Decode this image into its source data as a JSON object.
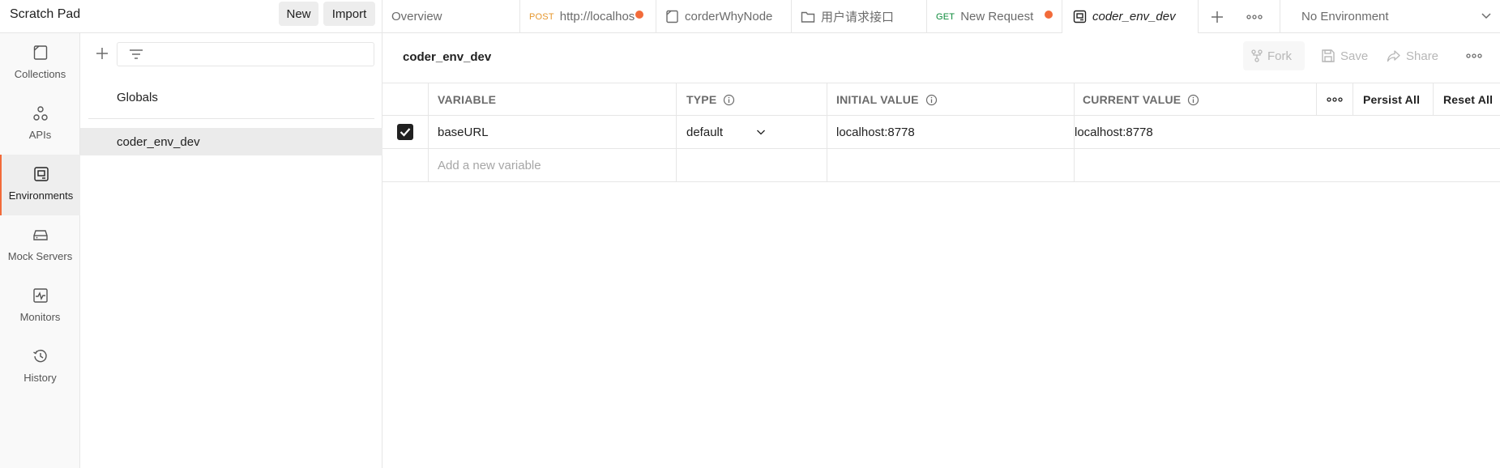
{
  "workspace": {
    "title": "Scratch Pad",
    "new_label": "New",
    "import_label": "Import"
  },
  "tabs": [
    {
      "label": "Overview"
    },
    {
      "method": "POST",
      "label": "http://localhos"
    },
    {
      "label": "corderWhyNode"
    },
    {
      "label": "用户请求接口"
    },
    {
      "method": "GET",
      "label": "New Request"
    },
    {
      "label": "coder_env_dev"
    }
  ],
  "environment_selector": {
    "value": "No Environment"
  },
  "rail": [
    {
      "label": "Collections"
    },
    {
      "label": "APIs"
    },
    {
      "label": "Environments"
    },
    {
      "label": "Mock Servers"
    },
    {
      "label": "Monitors"
    },
    {
      "label": "History"
    }
  ],
  "sidebar": {
    "items": [
      {
        "label": "Globals"
      },
      {
        "label": "coder_env_dev"
      }
    ]
  },
  "main": {
    "title": "coder_env_dev",
    "actions": {
      "fork": "Fork",
      "save": "Save",
      "share": "Share"
    },
    "table": {
      "headers": {
        "variable": "VARIABLE",
        "type": "TYPE",
        "initial": "INITIAL VALUE",
        "current": "CURRENT VALUE"
      },
      "persist_all": "Persist All",
      "reset_all": "Reset All",
      "rows": [
        {
          "variable": "baseURL",
          "type": "default",
          "initial": "localhost:8778",
          "current": "localhost:8778"
        }
      ],
      "new_row_placeholder": "Add a new variable"
    }
  },
  "colors": {
    "accent": "#f26b3a",
    "post": "#e6972d",
    "get": "#0c8a3a"
  }
}
